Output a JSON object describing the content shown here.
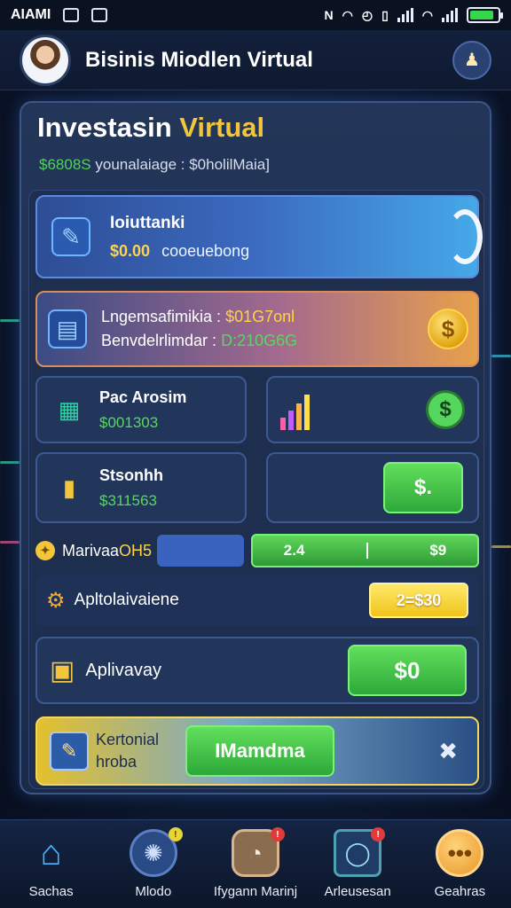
{
  "status_bar": {
    "carrier": "AIAMI"
  },
  "header": {
    "title": "Bisinis Miodlen Virtual"
  },
  "panel": {
    "title_main": "Investasin",
    "title_accent": "Virtual",
    "sub_green": "$6808S",
    "sub_text": "younalaiage : $0holilMaia]"
  },
  "card1": {
    "title": "Ioiuttanki",
    "amount": "$0.00",
    "desc": "cooeuebong"
  },
  "card2": {
    "line1_label": "Lngemsafimikia :",
    "line1_value": "$01G7onl",
    "line2_label": "Benvdelrlimdar :",
    "line2_value": "D:210G6G"
  },
  "card3": {
    "title": "Pac Arosim",
    "value": "$001303"
  },
  "card5": {
    "title": "Stsonhh",
    "value": "$311563"
  },
  "card6": {
    "button": "$."
  },
  "row_marivaa": {
    "label": "Marivaa",
    "label_accent": "OH5",
    "value_a": "2.4",
    "value_b": "$9"
  },
  "row_apltola": {
    "label": "Apltolaivaiene",
    "button": "2=$30"
  },
  "row_aplivay": {
    "label": "Aplivavay",
    "button": "$0"
  },
  "row_kertonial": {
    "line1": "Kertonial",
    "line2": "hroba",
    "button": "IMamdma"
  },
  "bottom_nav": [
    {
      "label": "Sachas"
    },
    {
      "label": "Mlodo"
    },
    {
      "label": "Ifygann Marinj"
    },
    {
      "label": "Arleusesan"
    },
    {
      "label": "Geahras"
    }
  ],
  "colors": {
    "accent_yellow": "#f2c53a",
    "green": "#4fd35a",
    "panel_border": "#3c5688"
  },
  "icons": [
    "document-icon",
    "coin-dollar-icon",
    "cash-icon",
    "bar-chart-icon",
    "gold-box-icon",
    "gear-icon",
    "folder-icon",
    "home-icon",
    "cog-icon",
    "clock-icon",
    "phone-icon",
    "chat-icon",
    "profile-icon"
  ]
}
